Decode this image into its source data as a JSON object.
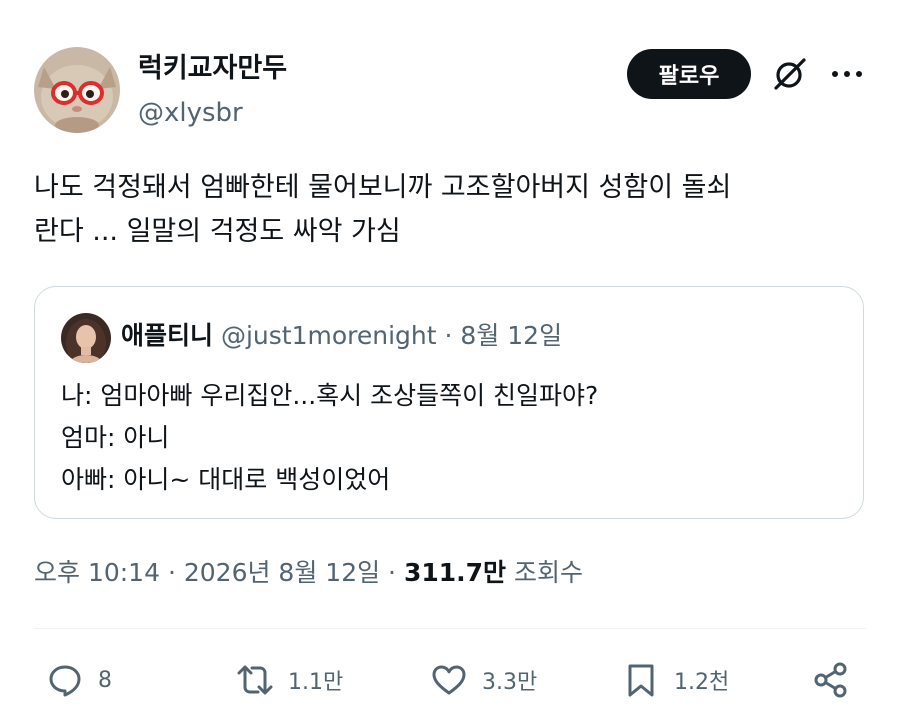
{
  "author": {
    "display_name": "럭키교자만두",
    "handle": "@xlysbr",
    "avatar_icon": "cat-with-glasses-avatar"
  },
  "header": {
    "follow_label": "팔로우",
    "grok_icon": "grok-icon",
    "more_icon": "more-dots-icon"
  },
  "tweet": {
    "lines": [
      "나도 걱정돼서 엄빠한테 물어보니까 고조할아버지 성함이 돌쇠",
      "란다 ... 일말의 걱정도 싸악 가심"
    ]
  },
  "quote": {
    "display_name": "애플티니",
    "handle": "@just1morenight",
    "separator": "·",
    "date": "8월 12일",
    "lines": [
      "나: 엄마아빠 우리집안...혹시 조상들쪽이 친일파야?",
      "엄마: 아니",
      "아빠: 아니~ 대대로 백성이었어"
    ]
  },
  "meta": {
    "time": "오후 10:14",
    "sep1": "·",
    "date": "2026년 8월 12일",
    "sep2": "·",
    "views_count": "311.7만",
    "views_label": "조회수"
  },
  "actions": {
    "reply": {
      "icon": "reply-icon",
      "count": "8"
    },
    "retweet": {
      "icon": "retweet-icon",
      "count": "1.1만"
    },
    "like": {
      "icon": "heart-icon",
      "count": "3.3만"
    },
    "bookmark": {
      "icon": "bookmark-icon",
      "count": "1.2천"
    },
    "share": {
      "icon": "share-icon"
    }
  },
  "colors": {
    "text": "#0f1419",
    "secondary": "#536471",
    "border": "#cfd9de",
    "button_bg": "#0f1419"
  }
}
